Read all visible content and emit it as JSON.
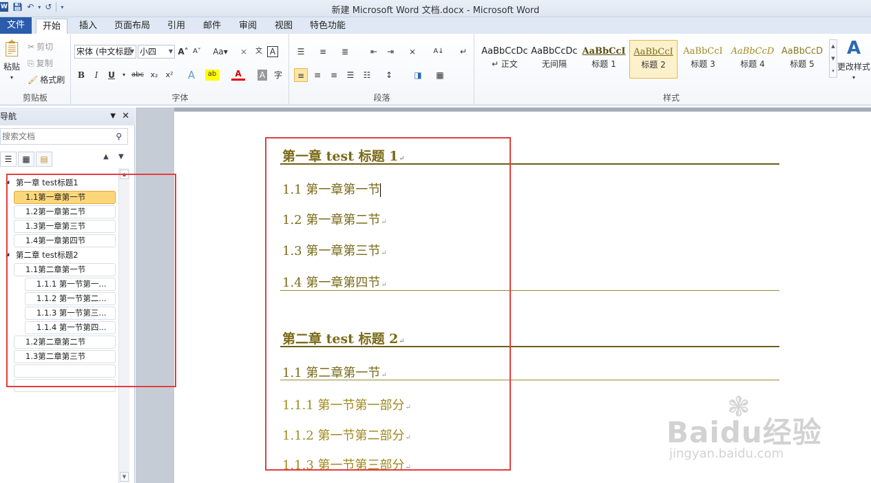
{
  "window": {
    "title": "新建 Microsoft Word 文档.docx - Microsoft Word"
  },
  "ribbon_tabs": [
    "文件",
    "开始",
    "插入",
    "页面布局",
    "引用",
    "邮件",
    "审阅",
    "视图",
    "特色功能"
  ],
  "clipboard": {
    "paste": "粘贴",
    "cut": "剪切",
    "copy": "复制",
    "format_painter": "格式刷",
    "group_label": "剪贴板"
  },
  "font": {
    "name": "宋体 (中文标题",
    "size": "小四",
    "group_label": "字体"
  },
  "paragraph": {
    "group_label": "段落"
  },
  "styles": {
    "items": [
      {
        "sample": "AaBbCcDc",
        "name": "↵ 正文"
      },
      {
        "sample": "AaBbCcDc",
        "name": "无间隔"
      },
      {
        "sample": "AaBbCcI",
        "name": "标题 1"
      },
      {
        "sample": "AaBbCcI",
        "name": "标题 2"
      },
      {
        "sample": "AaBbCcI",
        "name": "标题 3"
      },
      {
        "sample": "AaBbCcD",
        "name": "标题 4"
      },
      {
        "sample": "AaBbCcD",
        "name": "标题 5"
      }
    ],
    "change_styles": "更改样式",
    "group_label": "样式",
    "accent": "#7a6a18"
  },
  "nav": {
    "title": "导航",
    "search_placeholder": "搜索文档",
    "tree": [
      {
        "label": "第一章  test标题1",
        "level": 1
      },
      {
        "label": "1.1第一章第一节",
        "level": 2,
        "selected": true
      },
      {
        "label": "1.2第一章第二节",
        "level": 2
      },
      {
        "label": "1.3第一章第三节",
        "level": 2
      },
      {
        "label": "1.4第一章第四节",
        "level": 2
      },
      {
        "label": "第二章  test标题2",
        "level": 1
      },
      {
        "label": "1.1第二章第一节",
        "level": 2
      },
      {
        "label": "1.1.1 第一节第一...",
        "level": 3
      },
      {
        "label": "1.1.2 第一节第二...",
        "level": 3
      },
      {
        "label": "1.1.3 第一节第三...",
        "level": 3
      },
      {
        "label": "1.1.4 第一节第四...",
        "level": 3
      },
      {
        "label": "1.2第二章第二节",
        "level": 2
      },
      {
        "label": "1.3第二章第三节",
        "level": 2
      }
    ]
  },
  "document": {
    "lines": [
      {
        "text": "第一章   test 标题 1",
        "style": "h1"
      },
      {
        "text": "1.1 第一章第一节",
        "style": "h2"
      },
      {
        "text": "1.2 第一章第二节",
        "style": "h2"
      },
      {
        "text": "1.3 第一章第三节",
        "style": "h2"
      },
      {
        "text": "1.4 第一章第四节",
        "style": "h2"
      },
      {
        "text": "第二章   test 标题 2",
        "style": "h1"
      },
      {
        "text": "1.1 第二章第一节",
        "style": "h2"
      },
      {
        "text": "1.1.1  第一节第一部分",
        "style": "h3"
      },
      {
        "text": "1.1.2  第一节第二部分",
        "style": "h3"
      },
      {
        "text": "1.1.3  第一节第三部分",
        "style": "h3"
      }
    ]
  },
  "watermark": {
    "brand": "Baidu经验",
    "url": "jingyan.baidu.com"
  }
}
